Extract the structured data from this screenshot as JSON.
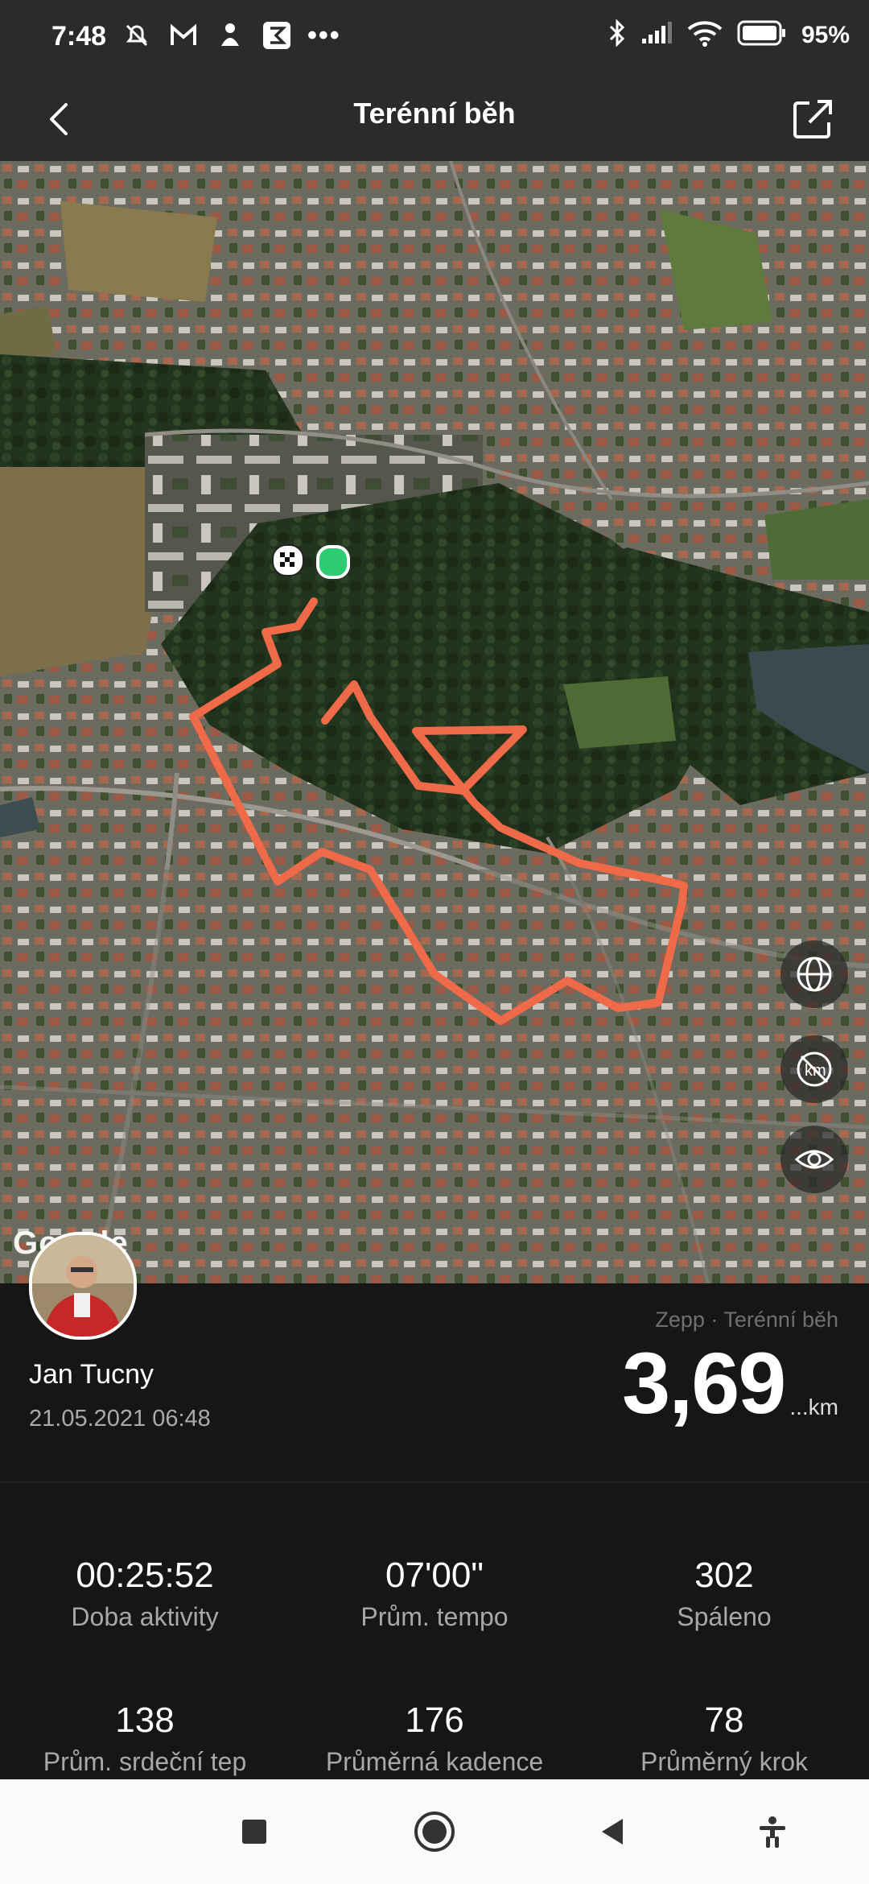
{
  "status_bar": {
    "time": "7:48",
    "left_icons": [
      "mute-alarm-icon",
      "gmail-icon",
      "person-icon",
      "sigma-icon",
      "more-dots-icon"
    ],
    "right_icons": [
      "bluetooth-icon",
      "signal-icon",
      "wifi-icon",
      "battery-icon"
    ],
    "battery": "95%"
  },
  "header": {
    "title": "Terénní běh",
    "back_icon": "back-chevron-icon",
    "share_icon": "share-icon"
  },
  "map": {
    "provider_logo": "Google",
    "route_color": "#ef6a48",
    "start_marker_color": "#2ecc71",
    "controls": [
      "globe-icon",
      "km-off-icon",
      "eye-icon"
    ]
  },
  "summary": {
    "user_name": "Jan Tucny",
    "date": "21.05.2021 06:48",
    "source": "Zepp · Terénní běh",
    "distance": "3,69",
    "distance_unit": "...km"
  },
  "stats": [
    {
      "value": "00:25:52",
      "label": "Doba aktivity"
    },
    {
      "value": "07'00\"",
      "label": "Prům. tempo"
    },
    {
      "value": "302",
      "label": "Spáleno"
    },
    {
      "value": "138",
      "label": "Prům. srdeční tep"
    },
    {
      "value": "176",
      "label": "Průměrná kadence"
    },
    {
      "value": "78",
      "label": "Průměrný krok"
    }
  ],
  "nav_bar": [
    "recents-square-icon",
    "home-circle-icon",
    "back-triangle-icon",
    "accessibility-icon"
  ]
}
